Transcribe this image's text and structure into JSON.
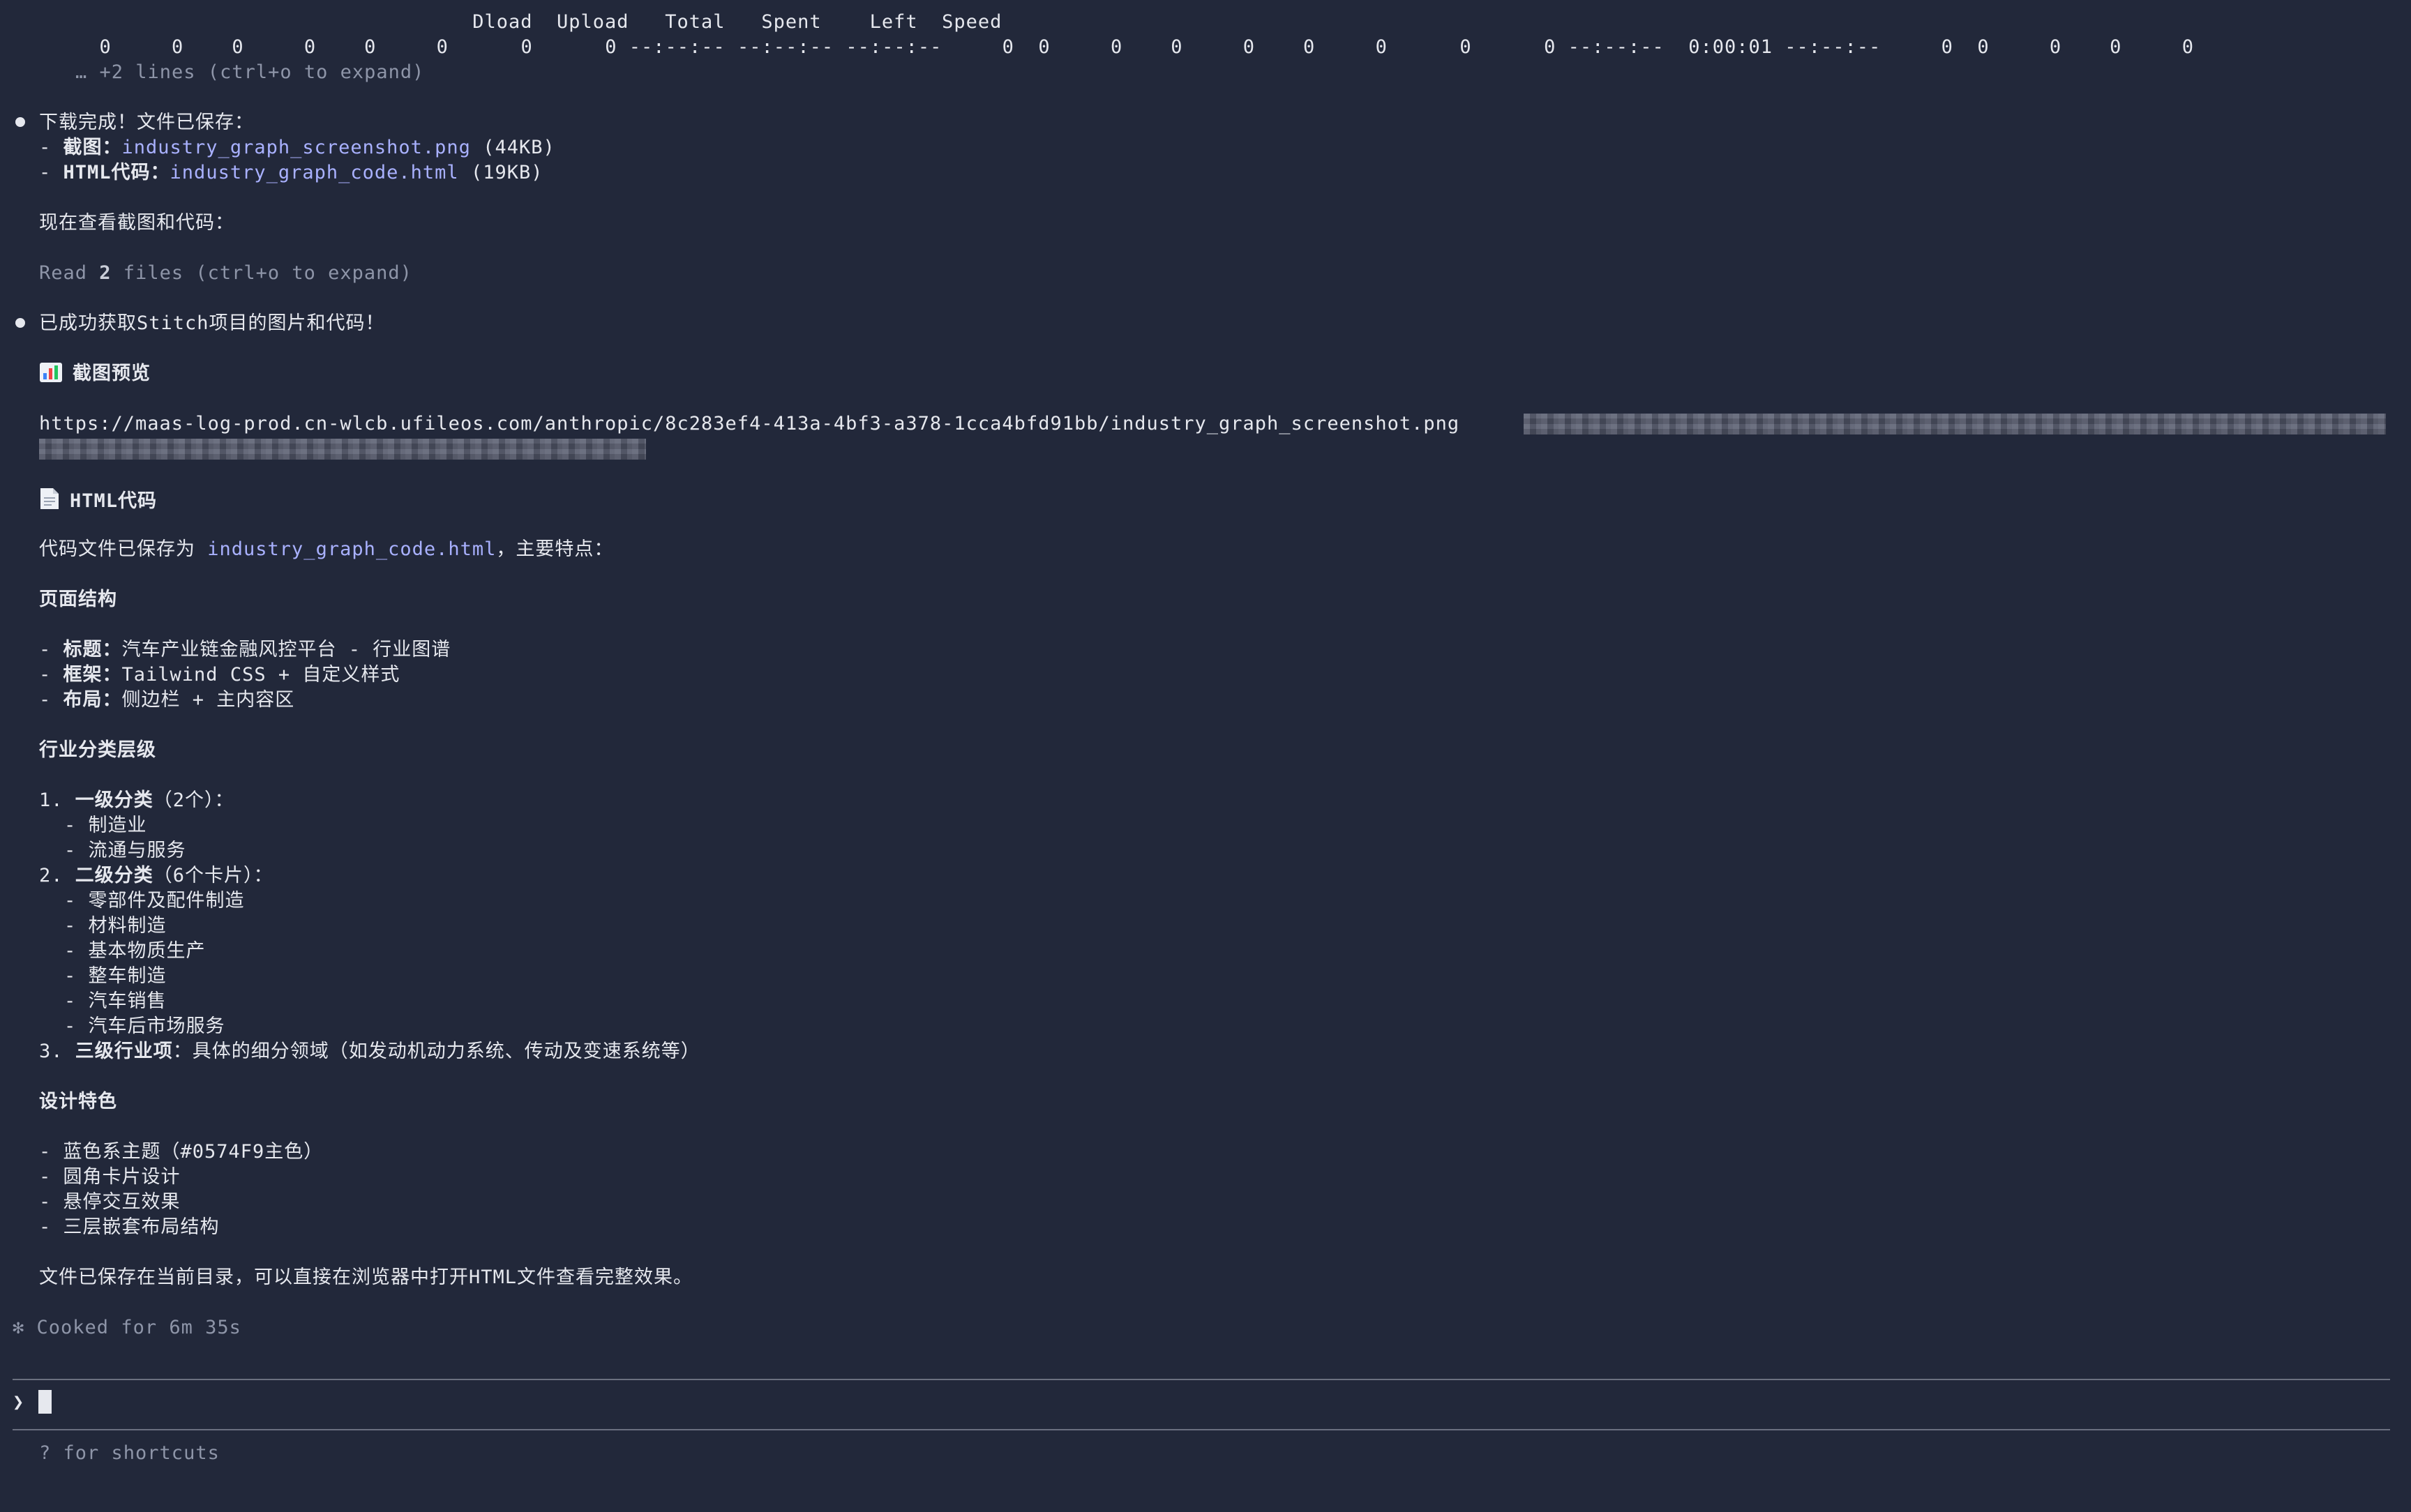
{
  "curl": {
    "header": "                                    Dload  Upload   Total   Spent    Left  Speed",
    "values": "  0     0    0     0    0     0      0      0 --:--:-- --:--:-- --:--:--     0  0     0    0     0    0     0      0      0 --:--:--  0:00:01 --:--:--     0  0     0    0     0",
    "more": "… +2 lines (ctrl+o to expand)"
  },
  "msg1": {
    "heading": "下载完成！文件已保存：",
    "screenshot_label": "截图：",
    "screenshot_file": "industry_graph_screenshot.png",
    "screenshot_size": "(44KB)",
    "html_label": "HTML代码：",
    "html_file": "industry_graph_code.html",
    "html_size": "(19KB)",
    "viewing": "现在查看截图和代码：",
    "read_prefix": "Read ",
    "read_count": "2",
    "read_suffix": " files (ctrl+o to expand)"
  },
  "msg2": {
    "heading": "已成功获取Stitch项目的图片和代码！",
    "preview_title": "截图预览",
    "preview_icon": "bar-chart-icon",
    "url": "https://maas-log-prod.cn-wlcb.ufileos.com/anthropic/8c283ef4-413a-4bf3-a378-1cca4bfd91bb/industry_graph_screenshot.png",
    "code_title": "HTML代码",
    "code_icon": "document-icon",
    "saved_prefix": "代码文件已保存为 ",
    "saved_file": "industry_graph_code.html",
    "saved_suffix": "，主要特点：",
    "structure_title": "页面结构",
    "structure": [
      {
        "label": "标题：",
        "value": "汽车产业链金融风控平台 - 行业图谱"
      },
      {
        "label": "框架：",
        "value": "Tailwind CSS + 自定义样式"
      },
      {
        "label": "布局：",
        "value": "侧边栏 + 主内容区"
      }
    ],
    "levels_title": "行业分类层级",
    "level1_label": "一级分类",
    "level1_count": "（2个）：",
    "level1_items": [
      "制造业",
      "流通与服务"
    ],
    "level2_label": "二级分类",
    "level2_count": "（6个卡片）：",
    "level2_items": [
      "零部件及配件制造",
      "材料制造",
      "基本物质生产",
      "整车制造",
      "汽车销售",
      "汽车后市场服务"
    ],
    "level3_label": "三级行业项",
    "level3_desc": "：具体的细分领域（如发动机动力系统、传动及变速系统等）",
    "design_title": "设计特色",
    "design_items": [
      "蓝色系主题（#0574F9主色）",
      "圆角卡片设计",
      "悬停交互效果",
      "三层嵌套布局结构"
    ],
    "closing": "文件已保存在当前目录，可以直接在浏览器中打开HTML文件查看完整效果。"
  },
  "status": {
    "symbol": "✻",
    "text": "Cooked for 6m 35s"
  },
  "prompt": {
    "symbol": "❯",
    "value": "",
    "hint": "? for shortcuts"
  },
  "colors": {
    "background": "#22283a",
    "text": "#e6e8ee",
    "dim": "#8e95a8",
    "link": "#a9b1ff"
  }
}
